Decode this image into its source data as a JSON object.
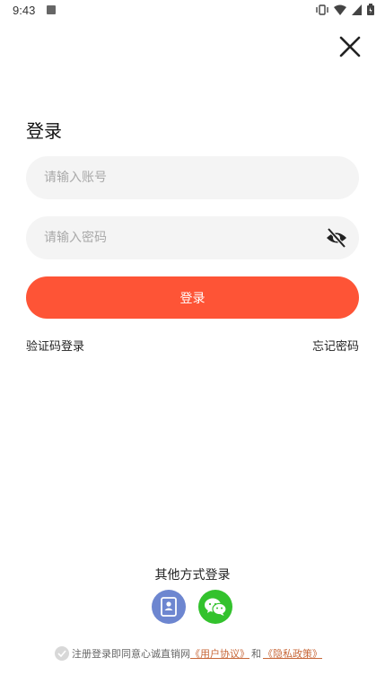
{
  "status_bar": {
    "time": "9:43",
    "icons": [
      "vibrate-icon",
      "wifi-icon",
      "signal-icon",
      "battery-icon"
    ]
  },
  "page": {
    "title": "登录"
  },
  "form": {
    "account_placeholder": "请输入账号",
    "password_placeholder": "请输入密码",
    "login_label": "登录",
    "sms_login_label": "验证码登录",
    "forgot_password_label": "忘记密码"
  },
  "other_login": {
    "title": "其他方式登录",
    "methods": [
      "phone-icon",
      "wechat-icon"
    ]
  },
  "agreement": {
    "prefix": "注册登录即同意心诚直销网",
    "user_agreement": "《用户协议》",
    "and": "和",
    "privacy_policy": "《隐私政策》"
  },
  "colors": {
    "primary": "#fe5436",
    "field_bg": "#f4f4f4",
    "phone_icon_bg": "#6d86d0",
    "wechat_icon_bg": "#33c22d",
    "link": "#c8683a"
  }
}
